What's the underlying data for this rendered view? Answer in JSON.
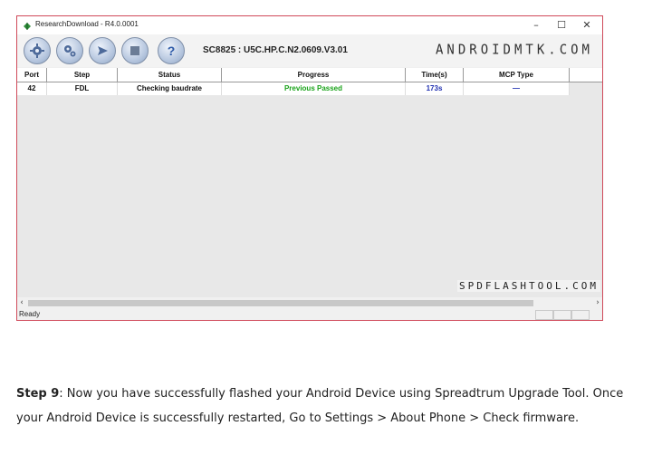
{
  "window": {
    "title": "ResearchDownload - R4.0.0001",
    "minimize_glyph": "–",
    "maximize_glyph": "☐",
    "close_glyph": "✕"
  },
  "toolbar": {
    "device_name": "SC8825 : U5C.HP.C.N2.0609.V3.01",
    "brand": "ANDROIDMTK.COM",
    "buttons": [
      "gear-icon",
      "gears-icon",
      "play-icon",
      "stop-icon",
      "help-icon"
    ]
  },
  "table": {
    "columns": [
      "Port",
      "Step",
      "Status",
      "Progress",
      "Time(s)",
      "MCP Type"
    ],
    "rows": [
      {
        "port": "42",
        "step": "FDL",
        "status": "Checking baudrate",
        "progress": "Previous Passed",
        "time": "173s",
        "mcp": "—"
      }
    ]
  },
  "watermark": "SPDFLASHTOOL.COM",
  "statusbar": {
    "text": "Ready"
  },
  "article": {
    "step_label": "Step 9",
    "text": ": Now you have successfully flashed your Android Device using Spreadtrum Upgrade Tool. Once your Android Device is successfully restarted, Go to Settings > About Phone > Check firmware."
  },
  "colors": {
    "progress_text": "#1aa31a",
    "time_text": "#1f2fb0",
    "window_border": "#d04a5a"
  }
}
